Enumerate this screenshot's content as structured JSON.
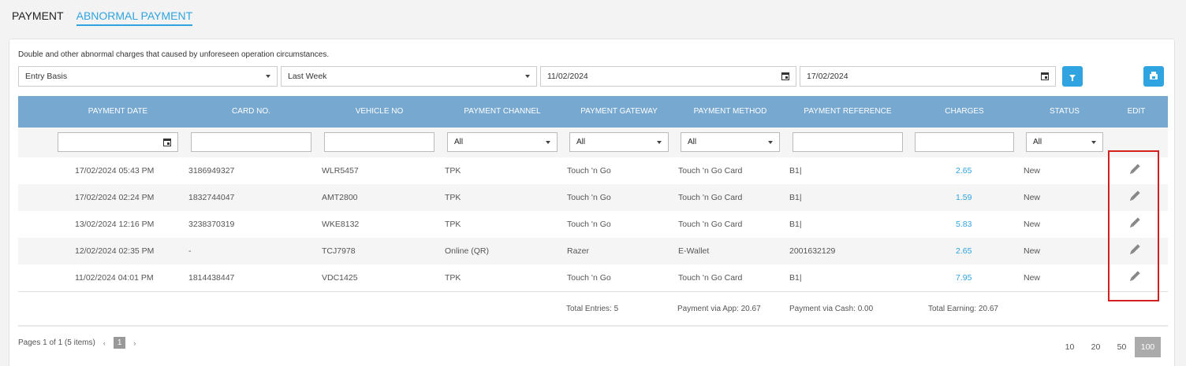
{
  "tabs": [
    {
      "label": "PAYMENT",
      "active": false
    },
    {
      "label": "ABNORMAL PAYMENT",
      "active": true
    }
  ],
  "description": "Double and other abnormal charges that caused by unforeseen operation circumstances.",
  "filters": {
    "basis": "Entry Basis",
    "period": "Last Week",
    "date_from": "11/02/2024",
    "date_to": "17/02/2024"
  },
  "table": {
    "columns": [
      "PAYMENT DATE",
      "CARD NO.",
      "VEHICLE NO",
      "PAYMENT CHANNEL",
      "PAYMENT GATEWAY",
      "PAYMENT METHOD",
      "PAYMENT REFERENCE",
      "CHARGES",
      "STATUS",
      "EDIT"
    ],
    "column_filters": {
      "channel": "All",
      "gateway": "All",
      "method": "All",
      "status": "All"
    },
    "rows": [
      {
        "date": "17/02/2024 05:43 PM",
        "card": "3186949327",
        "vehicle": "WLR5457",
        "channel": "TPK",
        "gateway": "Touch 'n Go",
        "method": "Touch 'n Go Card",
        "reference": "B1|",
        "charges": "2.65",
        "status": "New"
      },
      {
        "date": "17/02/2024 02:24 PM",
        "card": "1832744047",
        "vehicle": "AMT2800",
        "channel": "TPK",
        "gateway": "Touch 'n Go",
        "method": "Touch 'n Go Card",
        "reference": "B1|",
        "charges": "1.59",
        "status": "New"
      },
      {
        "date": "13/02/2024 12:16 PM",
        "card": "3238370319",
        "vehicle": "WKE8132",
        "channel": "TPK",
        "gateway": "Touch 'n Go",
        "method": "Touch 'n Go Card",
        "reference": "B1|",
        "charges": "5.83",
        "status": "New"
      },
      {
        "date": "12/02/2024 02:35 PM",
        "card": "-",
        "vehicle": "TCJ7978",
        "channel": "Online (QR)",
        "gateway": "Razer",
        "method": "E-Wallet",
        "reference": "2001632129",
        "charges": "2.65",
        "status": "New"
      },
      {
        "date": "11/02/2024 04:01 PM",
        "card": "1814438447",
        "vehicle": "VDC1425",
        "channel": "TPK",
        "gateway": "Touch 'n Go",
        "method": "Touch 'n Go Card",
        "reference": "B1|",
        "charges": "7.95",
        "status": "New"
      }
    ],
    "totals": {
      "entries": "Total Entries: 5",
      "via_app": "Payment via App: 20.67",
      "via_cash": "Payment via Cash: 0.00",
      "earning": "Total Earning: 20.67"
    }
  },
  "pager": {
    "info": "Pages 1 of 1 (5 items)",
    "prev": "‹",
    "current": "1",
    "next": "›",
    "sizes": [
      "10",
      "20",
      "50",
      "100"
    ],
    "active_size": "100"
  },
  "colors": {
    "accent": "#2fa4e0",
    "header": "#76a8d0",
    "highlight": "#d21f1f"
  }
}
